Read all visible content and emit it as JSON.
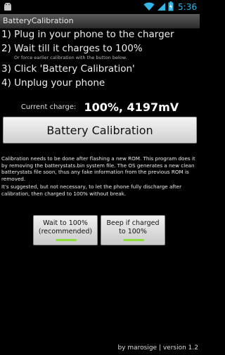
{
  "status_bar": {
    "time": "5:36",
    "icons": [
      "android-debug-icon",
      "wifi-icon",
      "signal-icon",
      "battery-charging-icon"
    ]
  },
  "title_bar": {
    "title": "BatteryCalibration"
  },
  "steps": {
    "step1": "1) Plug in your phone to the charger",
    "step2": "2) Wait till it charges to 100%",
    "step2_note": "Or force earlier calibration with the button below.",
    "step3": "3) Click 'Battery Calibration'",
    "step4": "4) Unplug your phone"
  },
  "charge": {
    "label": "Current charge:",
    "value": "100%, 4197mV"
  },
  "main_button": {
    "label": "Battery Calibration"
  },
  "info": {
    "paragraph1": "Calibration needs to be done after flashing a new ROM. This program does it by removing the batterystats.bin system file. The OS generates a new clean batterystats file soon, thus any fake information from the previous ROM is removed.",
    "paragraph2": "It's suggested, but not necessary, to let the phone fully discharge after calibration, then charged to 100% without break."
  },
  "toggles": {
    "wait": {
      "line1": "Wait to 100%",
      "line2": "(recommended)",
      "on": true
    },
    "beep": {
      "line1": "Beep if charged",
      "line2": "to 100%",
      "on": true
    },
    "indicator_color": "#8ee03a"
  },
  "footer": {
    "text": "by marosige | version 1.2"
  },
  "colors": {
    "accent_time": "#33b5e5",
    "background": "#000000"
  }
}
